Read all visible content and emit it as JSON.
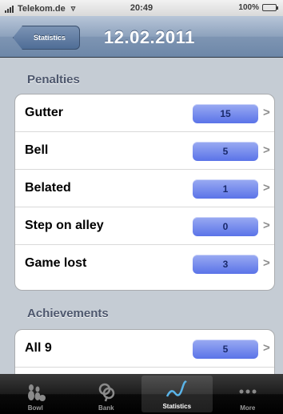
{
  "status_bar": {
    "carrier": "Telekom.de",
    "time": "20:49",
    "battery": "100%",
    "battery_level": 1.0
  },
  "nav": {
    "back_label": "Statistics",
    "title": "12.02.2011"
  },
  "sections": {
    "penalties": {
      "header": "Penalties",
      "rows": [
        {
          "label": "Gutter",
          "value": "15"
        },
        {
          "label": "Bell",
          "value": "5"
        },
        {
          "label": "Belated",
          "value": "1"
        },
        {
          "label": "Step on alley",
          "value": "0"
        },
        {
          "label": "Game lost",
          "value": "3"
        }
      ]
    },
    "achievements": {
      "header": "Achievements",
      "rows": [
        {
          "label": "All 9",
          "value": "5"
        }
      ]
    }
  },
  "tabs": [
    {
      "label": "Bowl",
      "icon": "bowling-pins-icon"
    },
    {
      "label": "Bank",
      "icon": "coins-icon"
    },
    {
      "label": "Statistics",
      "icon": "line-graph-icon",
      "active": true
    },
    {
      "label": "More",
      "icon": "more-dots-icon"
    }
  ],
  "colors": {
    "badge": "#6f86ec",
    "nav": "#7e95b3",
    "background": "#c5ccd4"
  }
}
